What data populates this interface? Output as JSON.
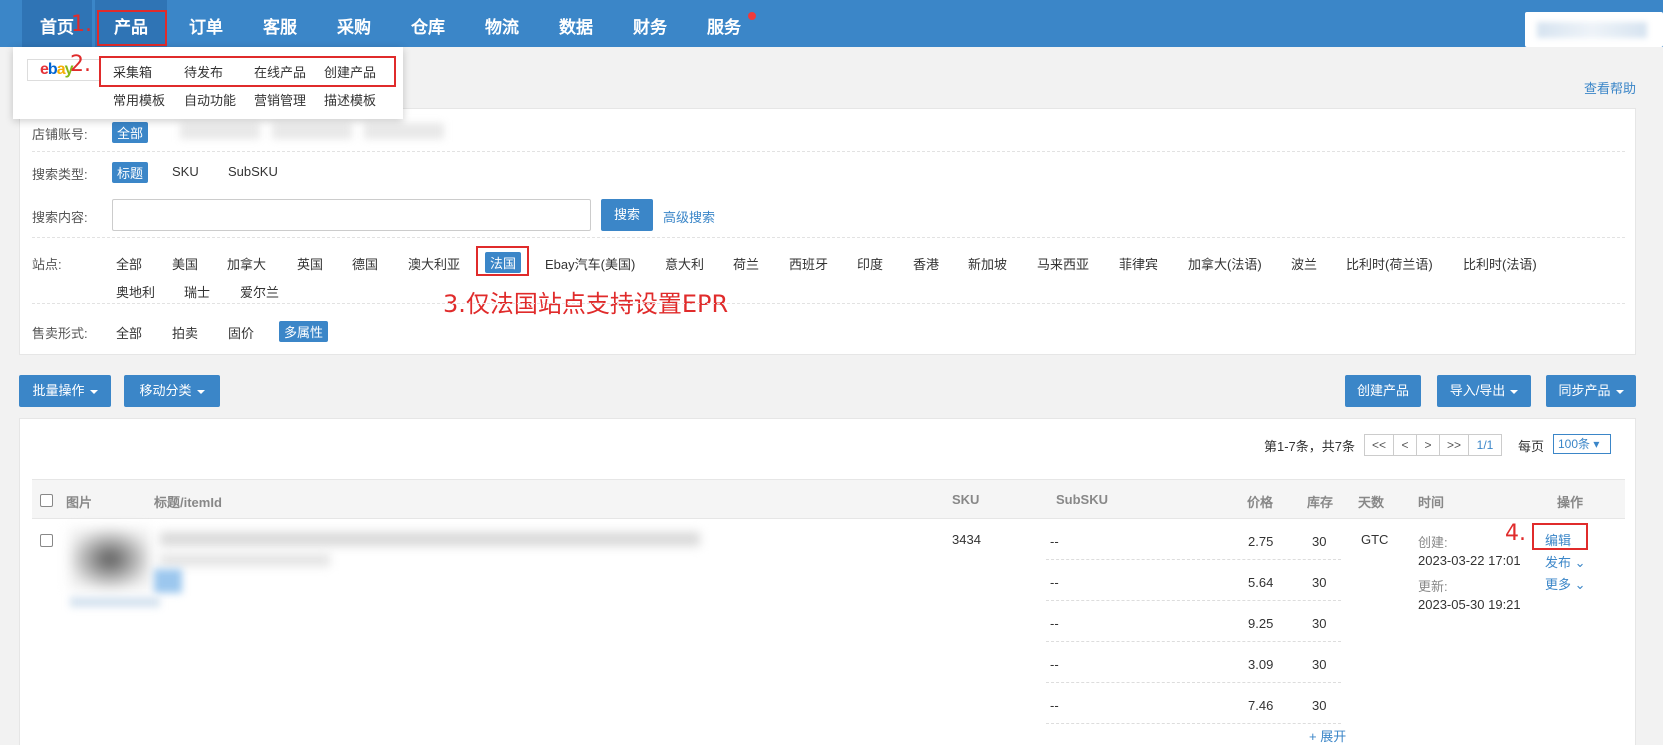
{
  "nav": {
    "items": [
      "首页",
      "产品",
      "订单",
      "客服",
      "采购",
      "仓库",
      "物流",
      "数据",
      "财务",
      "服务"
    ],
    "step1": "1.",
    "step2": "2."
  },
  "dropdown": {
    "row1": [
      "采集箱",
      "待发布",
      "在线产品",
      "创建产品"
    ],
    "row2": [
      "常用模板",
      "自动功能",
      "营销管理",
      "描述模板"
    ]
  },
  "help": "查看帮助",
  "filters": {
    "shop_label": "店铺账号:",
    "shop_all": "全部",
    "search_type_label": "搜索类型:",
    "search_types": [
      "标题",
      "SKU",
      "SubSKU"
    ],
    "search_content_label": "搜索内容:",
    "search_value": "",
    "search_button": "搜索",
    "advanced_search": "高级搜索",
    "site_label": "站点:",
    "sites_row1": [
      "全部",
      "美国",
      "加拿大",
      "英国",
      "德国",
      "澳大利亚",
      "法国",
      "Ebay汽车(美国)",
      "意大利",
      "荷兰",
      "西班牙",
      "印度",
      "香港",
      "新加坡",
      "马来西亚",
      "菲律宾",
      "加拿大(法语)",
      "波兰",
      "比利时(荷兰语)",
      "比利时(法语)"
    ],
    "sites_row2": [
      "奥地利",
      "瑞士",
      "爱尔兰"
    ],
    "selected_site": "法国",
    "epr_note": "3.仅法国站点支持设置EPR",
    "sale_label": "售卖形式:",
    "sale_types": [
      "全部",
      "拍卖",
      "固价",
      "多属性"
    ],
    "selected_sale": "多属性"
  },
  "toolbar": {
    "batch": "批量操作",
    "move": "移动分类",
    "create": "创建产品",
    "import_export": "导入/导出",
    "sync": "同步产品"
  },
  "pager": {
    "summary": "第1-7条，共7条",
    "first": "<<",
    "prev": "<",
    "next": ">",
    "last": ">>",
    "page": "1/1",
    "per_page_label": "每页",
    "per_page_value": "100条"
  },
  "table": {
    "headers": [
      "图片",
      "标题/itemId",
      "SKU",
      "SubSKU",
      "价格",
      "库存",
      "天数",
      "时间",
      "操作"
    ],
    "row": {
      "sku": "3434",
      "subskus": [
        {
          "sub": "--",
          "price": "2.75",
          "stock": "30"
        },
        {
          "sub": "--",
          "price": "5.64",
          "stock": "30"
        },
        {
          "sub": "--",
          "price": "9.25",
          "stock": "30"
        },
        {
          "sub": "--",
          "price": "3.09",
          "stock": "30"
        },
        {
          "sub": "--",
          "price": "7.46",
          "stock": "30"
        }
      ],
      "days": "GTC",
      "created_label": "创建:",
      "created": "2023-03-22 17:01",
      "updated_label": "更新:",
      "updated": "2023-05-30 19:21",
      "step4": "4.",
      "edit": "编辑",
      "publish": "发布",
      "more": "更多",
      "expand": "+ 展开"
    }
  }
}
